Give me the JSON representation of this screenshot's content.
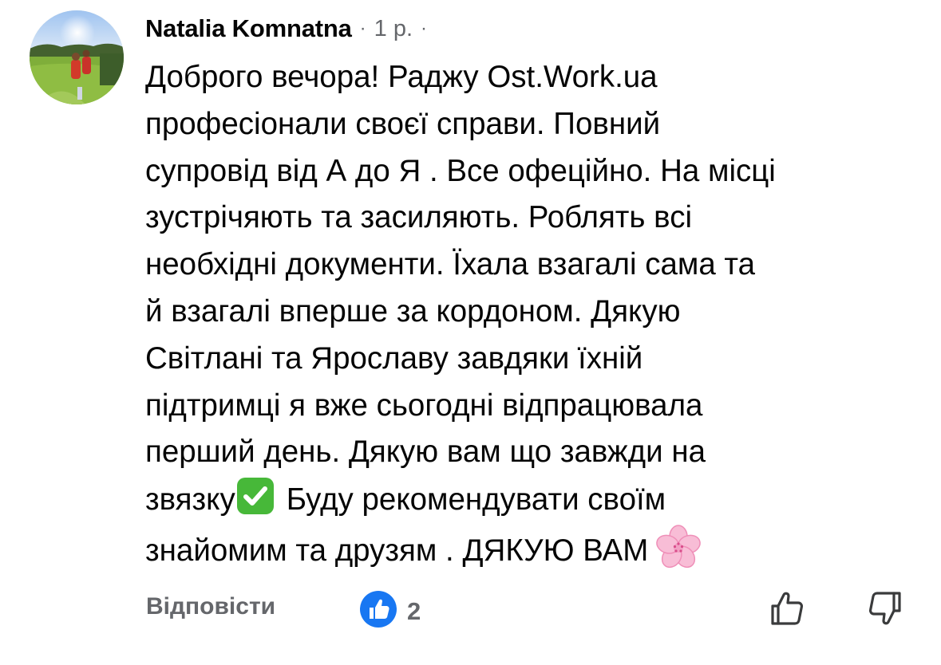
{
  "comment": {
    "author": "Natalia Komnatna",
    "separator_dot": "·",
    "time": "1 р.",
    "trailing_dot": "·",
    "avatar_icon": "avatar-photo",
    "text_lines": [
      "Доброго вечора! Раджу Ost.Work.ua",
      "професіонали своєї справи. Повний",
      "супровід від А до Я . Все офеційно. На місці",
      "зустрічяють та засиляють. Роблять всі",
      "необхідні документи.  Їхала взагалі сама та",
      "й взагалі вперше за кордоном. Дякую",
      "Світлані та Ярославу завдяки їхній",
      "підтримці я вже сьогодні відпрацювала",
      "перший день. Дякую вам що завжди на"
    ],
    "line10_before_emoji": "звязку",
    "line10_after_emoji": "Буду рекомендувати своїм",
    "line11_text": "знайомим та друзям . ДЯКУЮ ВАМ",
    "emoji_check_icon": "check-mark-button-emoji",
    "emoji_flower_icon": "cherry-blossom-emoji"
  },
  "actions": {
    "reply_label": "Відповісти",
    "reaction_icon": "like-reaction-icon",
    "reaction_count": "2",
    "like_icon": "thumbs-up-outline-icon",
    "dislike_icon": "thumbs-down-outline-icon"
  },
  "colors": {
    "text_primary": "#050505",
    "text_secondary": "#65676b",
    "like_blue": "#1877f2",
    "check_green": "#47b839",
    "blossom_pink": "#f7b6d2"
  }
}
